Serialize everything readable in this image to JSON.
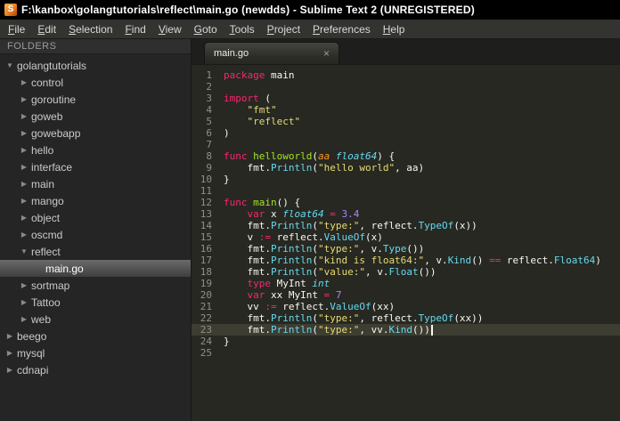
{
  "window": {
    "title": "F:\\kanbox\\golangtutorials\\reflect\\main.go (newdds) - Sublime Text 2 (UNREGISTERED)"
  },
  "menu": {
    "items": [
      "File",
      "Edit",
      "Selection",
      "Find",
      "View",
      "Goto",
      "Tools",
      "Project",
      "Preferences",
      "Help"
    ]
  },
  "icons": {
    "expanded": "▼",
    "collapsed": "▶",
    "close": "×",
    "app_glyph": "S"
  },
  "colors": {
    "titlebar_bg": "#000000",
    "menubar_bg": "#333330",
    "sidebar_bg": "#252525",
    "editor_bg": "#272822",
    "current_line": "#3e3d32",
    "keyword": "#f92672",
    "string": "#e6db74",
    "number": "#ae81ff",
    "type": "#66d9ef",
    "funcname": "#a6e22e",
    "param": "#fd971f",
    "text": "#f8f8f2",
    "line_number": "#8f908a"
  },
  "sidebar": {
    "header": "FOLDERS",
    "tree": [
      {
        "label": "golangtutorials",
        "level": 0,
        "state": "open"
      },
      {
        "label": "control",
        "level": 1,
        "state": "closed"
      },
      {
        "label": "goroutine",
        "level": 1,
        "state": "closed"
      },
      {
        "label": "goweb",
        "level": 1,
        "state": "closed"
      },
      {
        "label": "gowebapp",
        "level": 1,
        "state": "closed"
      },
      {
        "label": "hello",
        "level": 1,
        "state": "closed"
      },
      {
        "label": "interface",
        "level": 1,
        "state": "closed"
      },
      {
        "label": "main",
        "level": 1,
        "state": "closed"
      },
      {
        "label": "mango",
        "level": 1,
        "state": "closed"
      },
      {
        "label": "object",
        "level": 1,
        "state": "closed"
      },
      {
        "label": "oscmd",
        "level": 1,
        "state": "closed"
      },
      {
        "label": "reflect",
        "level": 1,
        "state": "open"
      },
      {
        "label": "main.go",
        "level": 2,
        "state": "file",
        "selected": true
      },
      {
        "label": "sortmap",
        "level": 1,
        "state": "closed"
      },
      {
        "label": "Tattoo",
        "level": 1,
        "state": "closed"
      },
      {
        "label": "web",
        "level": 1,
        "state": "closed"
      },
      {
        "label": "beego",
        "level": 0,
        "state": "closed"
      },
      {
        "label": "mysql",
        "level": 0,
        "state": "closed"
      },
      {
        "label": "cdnapi",
        "level": 0,
        "state": "closed"
      }
    ]
  },
  "editor": {
    "tab_label": "main.go",
    "lines": [
      {
        "n": 1,
        "tokens": [
          [
            "kw",
            "package"
          ],
          [
            "pl",
            " main"
          ]
        ]
      },
      {
        "n": 2,
        "tokens": []
      },
      {
        "n": 3,
        "tokens": [
          [
            "kw",
            "import"
          ],
          [
            "pl",
            " ("
          ]
        ]
      },
      {
        "n": 4,
        "tokens": [
          [
            "pl",
            "    "
          ],
          [
            "st",
            "\"fmt\""
          ]
        ]
      },
      {
        "n": 5,
        "tokens": [
          [
            "pl",
            "    "
          ],
          [
            "st",
            "\"reflect\""
          ]
        ]
      },
      {
        "n": 6,
        "tokens": [
          [
            "pl",
            ")"
          ]
        ]
      },
      {
        "n": 7,
        "tokens": []
      },
      {
        "n": 8,
        "tokens": [
          [
            "kw",
            "func"
          ],
          [
            "pl",
            " "
          ],
          [
            "fn",
            "helloworld"
          ],
          [
            "pl",
            "("
          ],
          [
            "param",
            "aa"
          ],
          [
            "pl",
            " "
          ],
          [
            "ty",
            "float64"
          ],
          [
            "pl",
            ") {"
          ]
        ]
      },
      {
        "n": 9,
        "tokens": [
          [
            "pl",
            "    fmt."
          ],
          [
            "lib",
            "Println"
          ],
          [
            "pl",
            "("
          ],
          [
            "st",
            "\"hello world\""
          ],
          [
            "pl",
            ", aa)"
          ]
        ]
      },
      {
        "n": 10,
        "tokens": [
          [
            "pl",
            "}"
          ]
        ]
      },
      {
        "n": 11,
        "tokens": []
      },
      {
        "n": 12,
        "tokens": [
          [
            "kw",
            "func"
          ],
          [
            "pl",
            " "
          ],
          [
            "fn",
            "main"
          ],
          [
            "pl",
            "() {"
          ]
        ]
      },
      {
        "n": 13,
        "tokens": [
          [
            "kw",
            "    var"
          ],
          [
            "pl",
            " x "
          ],
          [
            "ty",
            "float64"
          ],
          [
            "pl",
            " "
          ],
          [
            "kw",
            "="
          ],
          [
            "pl",
            " "
          ],
          [
            "num",
            "3.4"
          ]
        ]
      },
      {
        "n": 14,
        "tokens": [
          [
            "pl",
            "    fmt."
          ],
          [
            "lib",
            "Println"
          ],
          [
            "pl",
            "("
          ],
          [
            "st",
            "\"type:\""
          ],
          [
            "pl",
            ", reflect."
          ],
          [
            "lib",
            "TypeOf"
          ],
          [
            "pl",
            "(x))"
          ]
        ]
      },
      {
        "n": 15,
        "tokens": [
          [
            "pl",
            "    v "
          ],
          [
            "kw",
            ":="
          ],
          [
            "pl",
            " reflect."
          ],
          [
            "lib",
            "ValueOf"
          ],
          [
            "pl",
            "(x)"
          ]
        ]
      },
      {
        "n": 16,
        "tokens": [
          [
            "pl",
            "    fmt."
          ],
          [
            "lib",
            "Println"
          ],
          [
            "pl",
            "("
          ],
          [
            "st",
            "\"type:\""
          ],
          [
            "pl",
            ", v."
          ],
          [
            "lib",
            "Type"
          ],
          [
            "pl",
            "())"
          ]
        ]
      },
      {
        "n": 17,
        "tokens": [
          [
            "pl",
            "    fmt."
          ],
          [
            "lib",
            "Println"
          ],
          [
            "pl",
            "("
          ],
          [
            "st",
            "\"kind is float64:\""
          ],
          [
            "pl",
            ", v."
          ],
          [
            "lib",
            "Kind"
          ],
          [
            "pl",
            "() "
          ],
          [
            "kw",
            "=="
          ],
          [
            "pl",
            " reflect."
          ],
          [
            "lib",
            "Float64"
          ],
          [
            "pl",
            ")"
          ]
        ]
      },
      {
        "n": 18,
        "tokens": [
          [
            "pl",
            "    fmt."
          ],
          [
            "lib",
            "Println"
          ],
          [
            "pl",
            "("
          ],
          [
            "st",
            "\"value:\""
          ],
          [
            "pl",
            ", v."
          ],
          [
            "lib",
            "Float"
          ],
          [
            "pl",
            "())"
          ]
        ]
      },
      {
        "n": 19,
        "tokens": [
          [
            "kw",
            "    type"
          ],
          [
            "pl",
            " MyInt "
          ],
          [
            "ty",
            "int"
          ]
        ]
      },
      {
        "n": 20,
        "tokens": [
          [
            "kw",
            "    var"
          ],
          [
            "pl",
            " xx MyInt "
          ],
          [
            "kw",
            "="
          ],
          [
            "pl",
            " "
          ],
          [
            "num",
            "7"
          ]
        ]
      },
      {
        "n": 21,
        "tokens": [
          [
            "pl",
            "    vv "
          ],
          [
            "kw",
            ":="
          ],
          [
            "pl",
            " reflect."
          ],
          [
            "lib",
            "ValueOf"
          ],
          [
            "pl",
            "(xx)"
          ]
        ]
      },
      {
        "n": 22,
        "tokens": [
          [
            "pl",
            "    fmt."
          ],
          [
            "lib",
            "Println"
          ],
          [
            "pl",
            "("
          ],
          [
            "st",
            "\"type:\""
          ],
          [
            "pl",
            ", reflect."
          ],
          [
            "lib",
            "TypeOf"
          ],
          [
            "pl",
            "(xx))"
          ]
        ]
      },
      {
        "n": 23,
        "tokens": [
          [
            "pl",
            "    fmt."
          ],
          [
            "lib",
            "Println"
          ],
          [
            "pl",
            "("
          ],
          [
            "st",
            "\"type:\""
          ],
          [
            "pl",
            ", vv."
          ],
          [
            "lib",
            "Kind"
          ],
          [
            "pl",
            "())"
          ]
        ],
        "current": true,
        "cursor": true
      },
      {
        "n": 24,
        "tokens": [
          [
            "pl",
            "}"
          ]
        ]
      },
      {
        "n": 25,
        "tokens": []
      }
    ]
  }
}
